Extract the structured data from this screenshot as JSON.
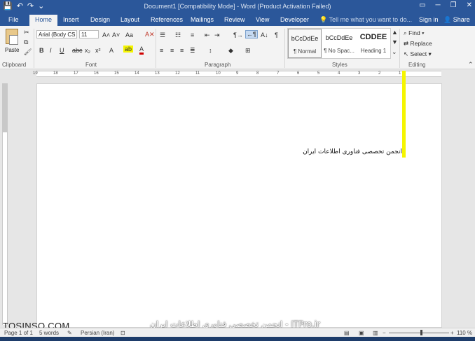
{
  "window": {
    "title": "Document1 [Compatibility Mode] - Word (Product Activation Failed)",
    "qat": {
      "save_icon": "save-icon",
      "undo_icon": "undo-icon",
      "redo_icon": "redo-icon"
    },
    "controls": {
      "restore": "▭",
      "minimize": "─",
      "maximize": "❐",
      "close": "✕"
    }
  },
  "tabs": [
    "File",
    "Home",
    "Insert",
    "Design",
    "Layout",
    "References",
    "Mailings",
    "Review",
    "View",
    "Developer"
  ],
  "active_tab": "Home",
  "tell_me": "Tell me what you want to do...",
  "account": {
    "sign_in": "Sign in",
    "share": "Share"
  },
  "ribbon": {
    "clipboard": {
      "label": "Clipboard",
      "paste": "Paste"
    },
    "font": {
      "label": "Font",
      "font_name": "Arial (Body CS",
      "font_size": "11",
      "grow": "A˄",
      "shrink": "A˅",
      "case": "Aa",
      "bold": "B",
      "italic": "I",
      "underline": "U",
      "strike": "abc",
      "subscript": "x₂",
      "superscript": "x²"
    },
    "paragraph": {
      "label": "Paragraph"
    },
    "styles": {
      "label": "Styles",
      "items": [
        {
          "sample": "bCcDdEe",
          "name": "¶ Normal"
        },
        {
          "sample": "bCcDdEe",
          "name": "¶ No Spac..."
        },
        {
          "sample": "CDDEE",
          "name": "Heading 1"
        }
      ]
    },
    "editing": {
      "label": "Editing",
      "find": "Find",
      "replace": "Replace",
      "select": "Select"
    }
  },
  "ruler": {
    "marks": [
      "19",
      "18",
      "17",
      "16",
      "15",
      "14",
      "13",
      "12",
      "11",
      "10",
      "9",
      "8",
      "7",
      "6",
      "5",
      "4",
      "3",
      "2",
      "1"
    ]
  },
  "document": {
    "text": "انجمن تخصصی فناوری اطلاعات ایران"
  },
  "watermarks": {
    "left": "TOSINSO.COM",
    "center": "انجمن تخصصی فناوری اطلاعات ایران - ITPro.ir"
  },
  "status": {
    "page": "Page 1 of 1",
    "words": "5 words",
    "language": "Persian (Iran)",
    "zoom": "110 %"
  },
  "colors": {
    "accent": "#2b579a",
    "highlight": "#f5f500"
  }
}
